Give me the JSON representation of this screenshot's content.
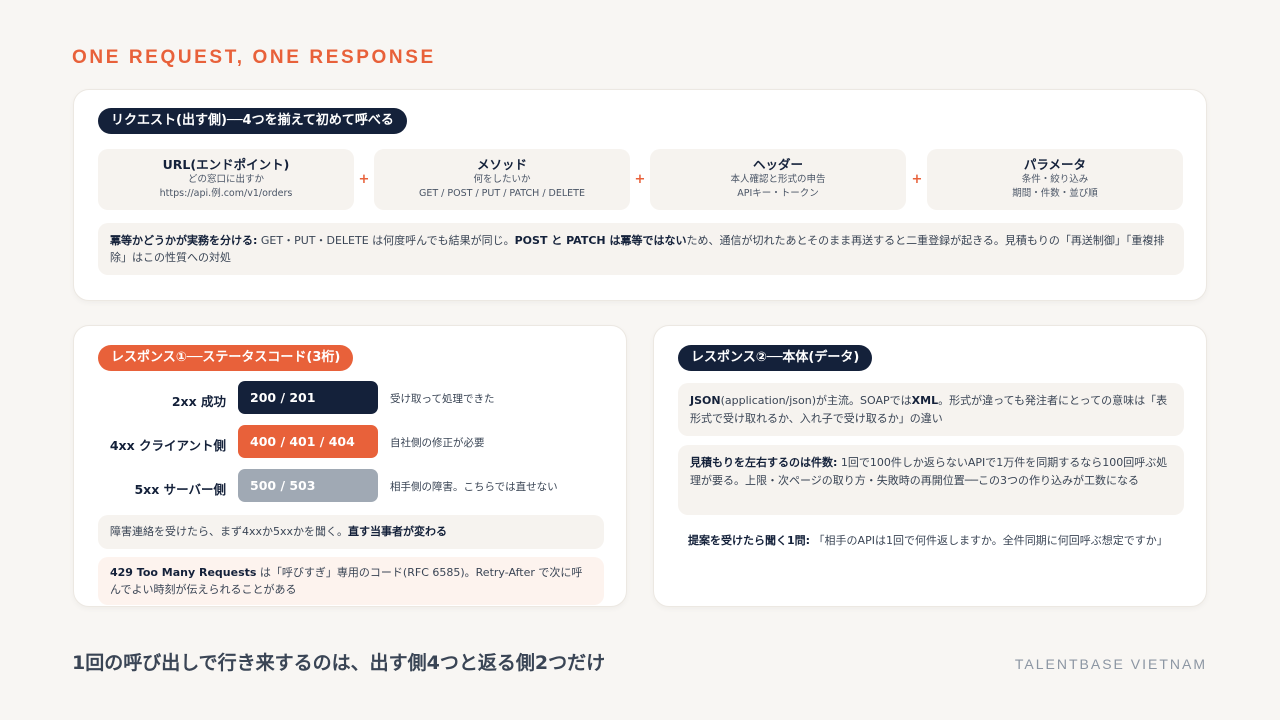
{
  "kicker": "ONE REQUEST, ONE RESPONSE",
  "request": {
    "pill": "リクエスト(出す側)──4つを揃えて初めて呼べる",
    "items": [
      {
        "title": "URL(エンドポイント)",
        "line1": "どの窓口に出すか",
        "line2": "https://api.例.com/v1/orders"
      },
      {
        "title": "メソッド",
        "line1": "何をしたいか",
        "line2": "GET / POST / PUT / PATCH / DELETE"
      },
      {
        "title": "ヘッダー",
        "line1": "本人確認と形式の申告",
        "line2": "APIキー・トークン"
      },
      {
        "title": "パラメータ",
        "line1": "条件・絞り込み",
        "line2": "期間・件数・並び順"
      }
    ],
    "plus": "+",
    "note": {
      "lead": "冪等かどうかが実務を分ける:",
      "text1": " GET・PUT・DELETE は何度呼んでも結果が同じ。",
      "strong": "POST と PATCH は冪等ではない",
      "text2": "ため、通信が切れたあとそのまま再送すると二重登録が起きる。見積もりの「再送制御」「重複排除」はこの性質への対処"
    }
  },
  "status": {
    "pill": "レスポンス①──ステータスコード(3桁)",
    "rows": [
      {
        "label": "2xx 成功",
        "codes": "200 / 201",
        "desc": "受け取って処理できた",
        "color": "#14213a"
      },
      {
        "label": "4xx クライアント側",
        "codes": "400 / 401 / 404",
        "desc": "自社側の修正が必要",
        "color": "#e8613a"
      },
      {
        "label": "5xx サーバー側",
        "codes": "500 / 503",
        "desc": "相手側の障害。こちらでは直せない",
        "color": "#a0a9b4"
      }
    ],
    "note1": {
      "text": "障害連絡を受けたら、まず4xxか5xxかを聞く。",
      "strong": "直す当事者が変わる"
    },
    "note2": {
      "strong": "429 Too Many Requests",
      "text": " は「呼びすぎ」専用のコード(RFC 6585)。Retry-After で次に呼んでよい時刻が伝えられることがある"
    }
  },
  "body": {
    "pill": "レスポンス②──本体(データ)",
    "note1": {
      "s1": "JSON",
      "t1": "(application/json)が主流。SOAPでは",
      "s2": "XML",
      "t2": "。形式が違っても発注者にとっての意味は「表形式で受け取れるか、入れ子で受け取るか」の違い"
    },
    "note2": {
      "strong": "見積もりを左右するのは件数:",
      "text": " 1回で100件しか返らないAPIで1万件を同期するなら100回呼ぶ処理が要る。上限・次ページの取り方・失敗時の再開位置──この3つの作り込みが工数になる"
    },
    "note3": {
      "strong": "提案を受けたら聞く1問:",
      "text": " 「相手のAPIは1回で何件返しますか。全件同期に何回呼ぶ想定ですか」"
    }
  },
  "footer": {
    "headline": "1回の呼び出しで行き来するのは、出す側4つと返る側2つだけ",
    "brand": "TALENTBASE VIETNAM"
  }
}
